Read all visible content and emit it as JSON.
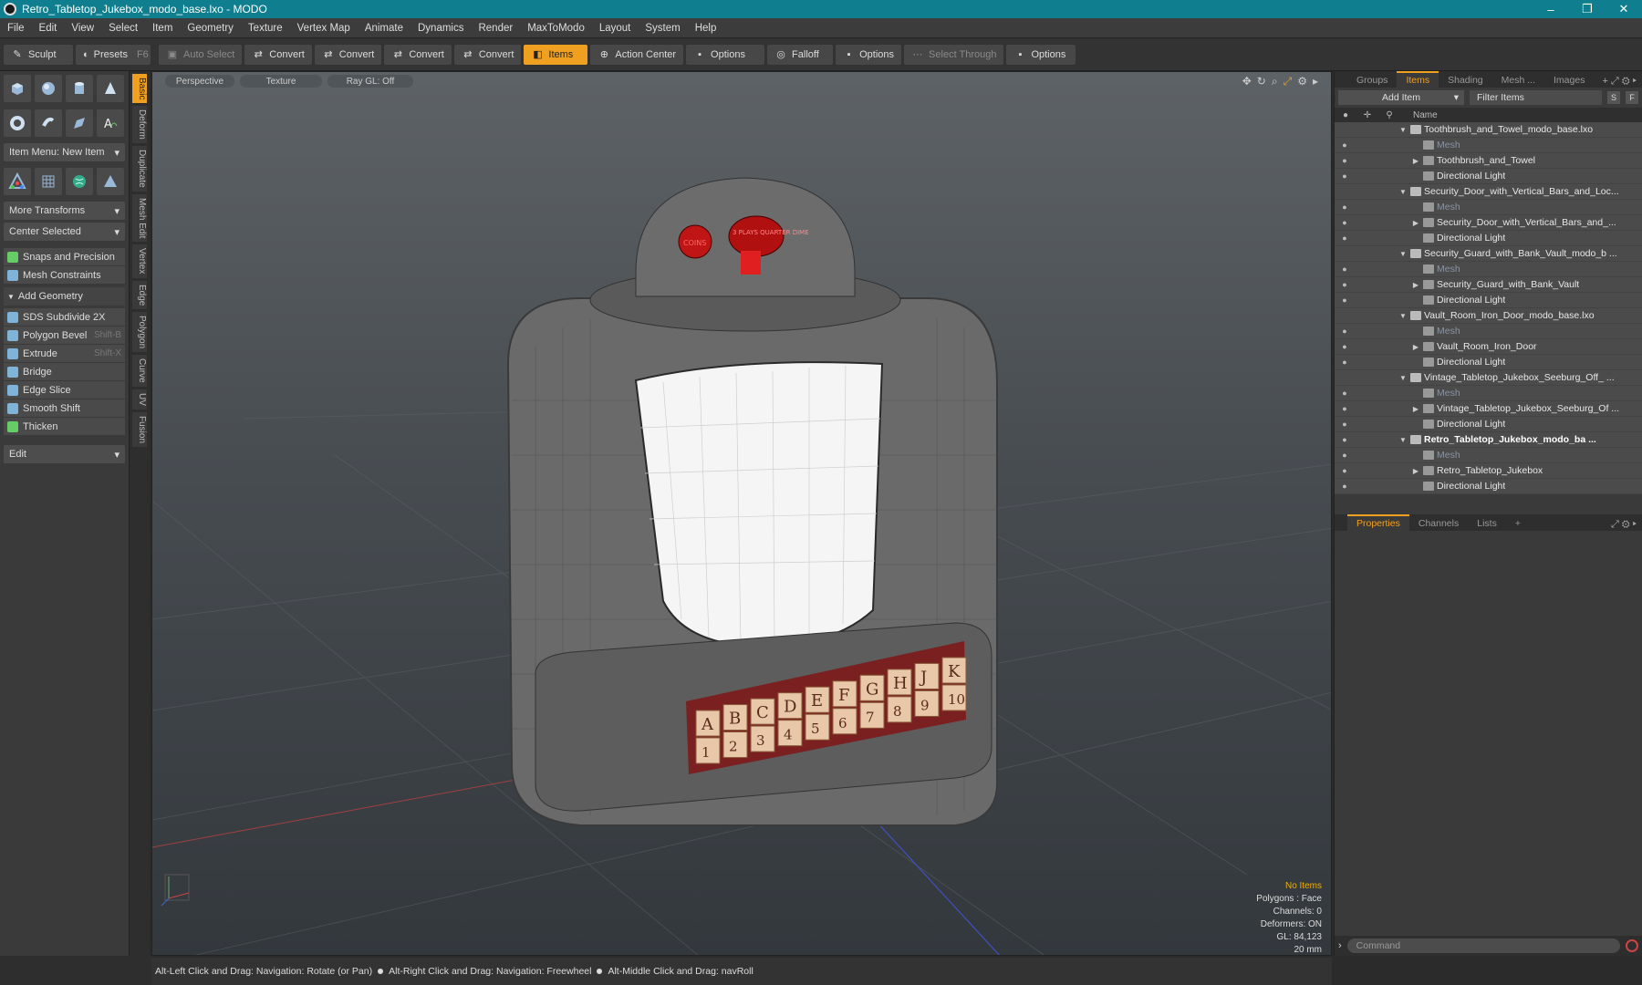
{
  "window": {
    "title": "Retro_Tabletop_Jukebox_modo_base.lxo - MODO",
    "minimize": "–",
    "maximize": "❐",
    "close": "✕"
  },
  "menu": [
    "File",
    "Edit",
    "View",
    "Select",
    "Item",
    "Geometry",
    "Texture",
    "Vertex Map",
    "Animate",
    "Dynamics",
    "Render",
    "MaxToModo",
    "Layout",
    "System",
    "Help"
  ],
  "toolbar": {
    "sculpt": "Sculpt",
    "presets": "Presets",
    "presets_key": "F6",
    "auto_select": "Auto Select",
    "convert1": "Convert",
    "convert2": "Convert",
    "convert3": "Convert",
    "convert4": "Convert",
    "items": "Items",
    "action_center": "Action Center",
    "options1": "Options",
    "falloff": "Falloff",
    "options2": "Options",
    "select_through": "Select Through",
    "options3": "Options"
  },
  "leftpanel": {
    "item_menu": "Item Menu: New Item",
    "more_transforms": "More Transforms",
    "center_selected": "Center Selected",
    "snaps": "Snaps and Precision",
    "mesh_constraints": "Mesh Constraints",
    "add_geometry": "Add Geometry",
    "tools": [
      {
        "label": "SDS Subdivide 2X",
        "key": ""
      },
      {
        "label": "Polygon Bevel",
        "key": "Shift-B"
      },
      {
        "label": "Extrude",
        "key": "Shift-X"
      },
      {
        "label": "Bridge",
        "key": ""
      },
      {
        "label": "Edge Slice",
        "key": ""
      },
      {
        "label": "Smooth Shift",
        "key": ""
      },
      {
        "label": "Thicken",
        "key": ""
      }
    ],
    "edit": "Edit"
  },
  "vtabs": [
    "Basic",
    "Deform",
    "Duplicate",
    "Mesh Edit",
    "Vertex",
    "Edge",
    "Polygon",
    "Curve",
    "UV",
    "Fusion"
  ],
  "viewport": {
    "view": "Perspective",
    "shading": "Texture",
    "raygl": "Ray GL: Off",
    "hud": {
      "selection": "No Items",
      "polygons": "Polygons : Face",
      "channels": "Channels: 0",
      "deformers": "Deformers: ON",
      "gl": "GL: 84,123",
      "scale": "20 mm"
    },
    "jukebox_letters": [
      "A",
      "B",
      "C",
      "D",
      "E",
      "F",
      "G",
      "H",
      "J",
      "K"
    ],
    "jukebox_numbers": [
      "1",
      "2",
      "3",
      "4",
      "5",
      "6",
      "7",
      "8",
      "9",
      "10"
    ],
    "coin_label": "COINS",
    "plays_label": "3 PLAYS QUARTER DIME"
  },
  "rightpanel": {
    "tabs": [
      "Groups",
      "Items",
      "Shading",
      "Mesh ...",
      "Images"
    ],
    "add_item": "Add Item",
    "filter": "Filter Items",
    "s_btn": "S",
    "f_btn": "F",
    "col_name": "Name",
    "tree": [
      {
        "label": "Toothbrush_and_Towel_modo_base.lxo",
        "type": "scene",
        "depth": 0,
        "exp": "▼",
        "eye": ""
      },
      {
        "label": "Mesh",
        "type": "mesh",
        "depth": 1,
        "exp": "",
        "eye": "●"
      },
      {
        "label": "Toothbrush_and_Towel",
        "type": "item",
        "depth": 1,
        "exp": "▶",
        "eye": "●"
      },
      {
        "label": "Directional Light",
        "type": "light",
        "depth": 1,
        "exp": "",
        "eye": "●"
      },
      {
        "label": "Security_Door_with_Vertical_Bars_and_Loc...",
        "type": "scene",
        "depth": 0,
        "exp": "▼",
        "eye": ""
      },
      {
        "label": "Mesh",
        "type": "mesh",
        "depth": 1,
        "exp": "",
        "eye": "●"
      },
      {
        "label": "Security_Door_with_Vertical_Bars_and_...",
        "type": "item",
        "depth": 1,
        "exp": "▶",
        "eye": "●"
      },
      {
        "label": "Directional Light",
        "type": "light",
        "depth": 1,
        "exp": "",
        "eye": "●"
      },
      {
        "label": "Security_Guard_with_Bank_Vault_modo_b ...",
        "type": "scene",
        "depth": 0,
        "exp": "▼",
        "eye": ""
      },
      {
        "label": "Mesh",
        "type": "mesh",
        "depth": 1,
        "exp": "",
        "eye": "●"
      },
      {
        "label": "Security_Guard_with_Bank_Vault",
        "type": "item",
        "depth": 1,
        "exp": "▶",
        "eye": "●"
      },
      {
        "label": "Directional Light",
        "type": "light",
        "depth": 1,
        "exp": "",
        "eye": "●"
      },
      {
        "label": "Vault_Room_Iron_Door_modo_base.lxo",
        "type": "scene",
        "depth": 0,
        "exp": "▼",
        "eye": ""
      },
      {
        "label": "Mesh",
        "type": "mesh",
        "depth": 1,
        "exp": "",
        "eye": "●"
      },
      {
        "label": "Vault_Room_Iron_Door",
        "type": "item",
        "depth": 1,
        "exp": "▶",
        "eye": "●"
      },
      {
        "label": "Directional Light",
        "type": "light",
        "depth": 1,
        "exp": "",
        "eye": "●"
      },
      {
        "label": "Vintage_Tabletop_Jukebox_Seeburg_Off_ ...",
        "type": "scene",
        "depth": 0,
        "exp": "▼",
        "eye": ""
      },
      {
        "label": "Mesh",
        "type": "mesh",
        "depth": 1,
        "exp": "",
        "eye": "●"
      },
      {
        "label": "Vintage_Tabletop_Jukebox_Seeburg_Of ...",
        "type": "item",
        "depth": 1,
        "exp": "▶",
        "eye": "●"
      },
      {
        "label": "Directional Light",
        "type": "light",
        "depth": 1,
        "exp": "",
        "eye": "●"
      },
      {
        "label": "Retro_Tabletop_Jukebox_modo_ba ...",
        "type": "scene-bold",
        "depth": 0,
        "exp": "▼",
        "eye": "●"
      },
      {
        "label": "Mesh",
        "type": "mesh",
        "depth": 1,
        "exp": "",
        "eye": "●"
      },
      {
        "label": "Retro_Tabletop_Jukebox",
        "type": "item",
        "depth": 1,
        "exp": "▶",
        "eye": "●"
      },
      {
        "label": "Directional Light",
        "type": "light",
        "depth": 1,
        "exp": "",
        "eye": "●"
      }
    ],
    "prop_tabs": [
      "Properties",
      "Channels",
      "Lists"
    ],
    "command_placeholder": "Command"
  },
  "status": {
    "hint1": "Alt-Left Click and Drag: Navigation: Rotate (or Pan)",
    "hint2": "Alt-Right Click and Drag: Navigation: Freewheel",
    "hint3": "Alt-Middle Click and Drag: navRoll"
  },
  "colors": {
    "accent": "#f0a020",
    "titlebar": "#0f7f8f"
  }
}
